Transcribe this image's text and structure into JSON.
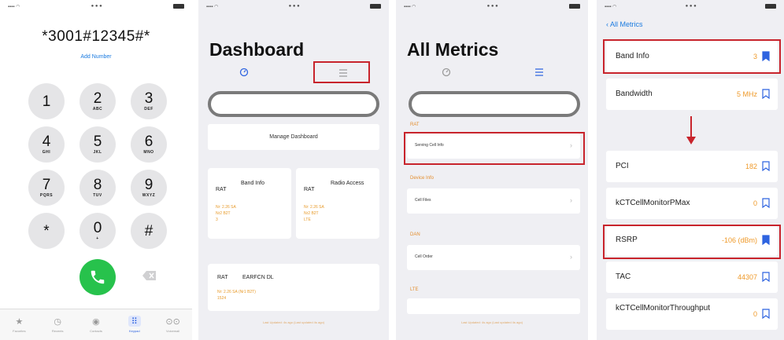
{
  "dialer": {
    "number": "*3001#12345#*",
    "add_number": "Add Number",
    "keys": [
      {
        "digit": "1",
        "letters": ""
      },
      {
        "digit": "2",
        "letters": "ABC"
      },
      {
        "digit": "3",
        "letters": "DEF"
      },
      {
        "digit": "4",
        "letters": "GHI"
      },
      {
        "digit": "5",
        "letters": "JKL"
      },
      {
        "digit": "6",
        "letters": "MNO"
      },
      {
        "digit": "7",
        "letters": "PQRS"
      },
      {
        "digit": "8",
        "letters": "TUV"
      },
      {
        "digit": "9",
        "letters": "WXYZ"
      },
      {
        "digit": "*",
        "letters": ""
      },
      {
        "digit": "0",
        "letters": "+"
      },
      {
        "digit": "#",
        "letters": ""
      }
    ],
    "tabs": [
      {
        "label": "Favorites",
        "icon": "star-icon"
      },
      {
        "label": "Recents",
        "icon": "clock-icon"
      },
      {
        "label": "Contacts",
        "icon": "contacts-icon"
      },
      {
        "label": "Keypad",
        "icon": "keypad-icon"
      },
      {
        "label": "Voicemail",
        "icon": "voicemail-icon"
      }
    ],
    "call_color": "#27c24c"
  },
  "dashboard": {
    "title": "Dashboard",
    "manage_label": "Manage Dashboard",
    "cards": [
      {
        "tag": "RAT",
        "title": "Band Info",
        "values": [
          "Nr: 2.26 SA",
          "Nr2 B2T",
          "3"
        ]
      },
      {
        "tag": "RAT",
        "title": "Radio Access",
        "values": [
          "Nr: 2.26 SA",
          "Nr2 B2T",
          "LTE"
        ]
      },
      {
        "tag": "RAT",
        "title": "EARFCN DL",
        "values": [
          "Nr: 2.26 SA (Nr1 B2T)",
          "1524"
        ]
      }
    ],
    "footer": "Last Updated: 4s ago (Last updated 4s ago)"
  },
  "all_metrics": {
    "title": "All Metrics",
    "sections": [
      {
        "label": "RAT",
        "row": "Serving Cell Info"
      },
      {
        "label": "Device Info",
        "row": "Cell Files"
      },
      {
        "label": "DAN",
        "row": "Cell Order"
      },
      {
        "label": "LTE",
        "row": ""
      }
    ],
    "footer": "Last Updated: 4s ago (Last updated 4s ago)"
  },
  "metrics_detail": {
    "back_label": "All Metrics",
    "top_rows": [
      {
        "label": "Band Info",
        "value": "3",
        "bookmarked": true
      },
      {
        "label": "Bandwidth",
        "value": "5 MHz",
        "bookmarked": false
      }
    ],
    "bottom_rows": [
      {
        "label": "PCI",
        "value": "182",
        "bookmarked": false
      },
      {
        "label": "kCTCellMonitorPMax",
        "value": "0",
        "bookmarked": false
      },
      {
        "label": "RSRP",
        "value": "-106 (dBm)",
        "bookmarked": true
      },
      {
        "label": "TAC",
        "value": "44307",
        "bookmarked": false
      },
      {
        "label": "kCTCellMonitorThroughput",
        "value": "0",
        "bookmarked": false
      }
    ]
  },
  "colors": {
    "accent_red": "#c8242c",
    "ios_blue": "#1b7be0",
    "value_orange": "#ef9a2a"
  }
}
